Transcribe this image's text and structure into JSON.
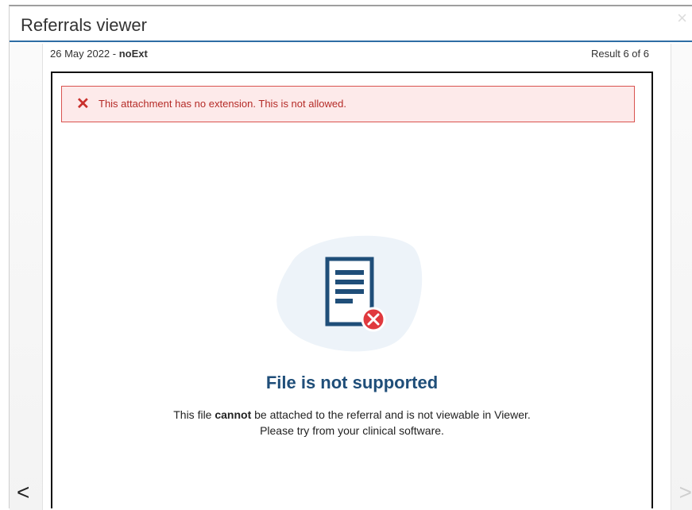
{
  "window": {
    "title": "Referrals viewer",
    "close_glyph": "×"
  },
  "meta": {
    "date": "26 May 2022",
    "separator": " - ",
    "filename": "noExt",
    "result": "Result 6 of 6"
  },
  "alert": {
    "icon": "close-icon",
    "message": "This attachment has no extension. This is not allowed.",
    "color": "#c9302c"
  },
  "empty_state": {
    "icon": "document-error-icon",
    "title": "File is not supported",
    "desc_part1": "This file ",
    "desc_bold": "cannot",
    "desc_part2": " be attached to the referral and is not viewable in Viewer.",
    "desc_line2": "Please try from your clinical software."
  },
  "nav": {
    "prev_glyph": "<",
    "next_glyph": ">"
  },
  "colors": {
    "accent": "#2e6da4",
    "title": "#1f4e79",
    "error": "#e0393e"
  }
}
